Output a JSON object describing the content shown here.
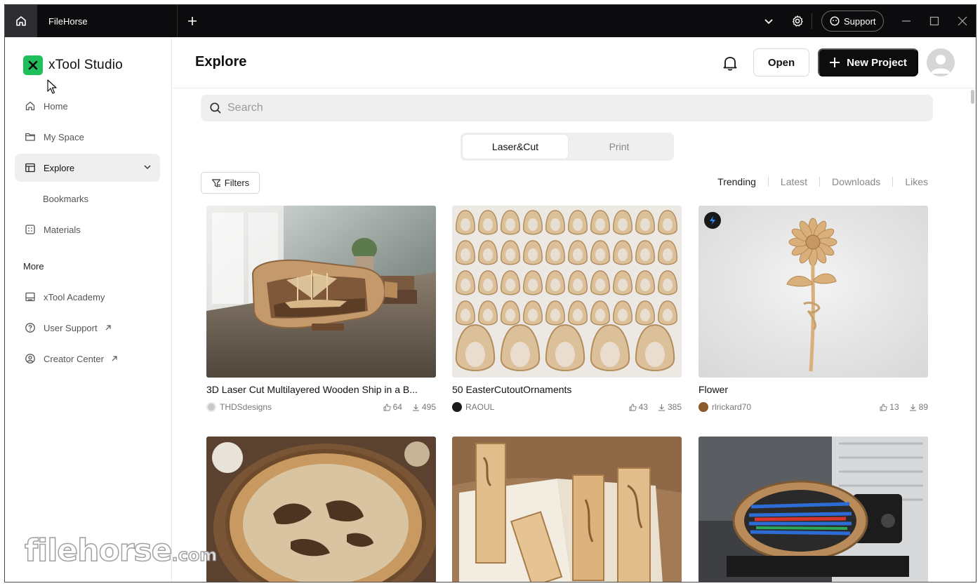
{
  "titlebar": {
    "tab_title": "FileHorse",
    "support_label": "Support"
  },
  "sidebar": {
    "app_name": "xTool Studio",
    "items": [
      {
        "label": "Home",
        "icon": "home-icon"
      },
      {
        "label": "My Space",
        "icon": "folder-icon"
      },
      {
        "label": "Explore",
        "icon": "explore-icon"
      },
      {
        "label": "Bookmarks"
      },
      {
        "label": "Materials",
        "icon": "grid-icon"
      }
    ],
    "more_label": "More",
    "more_items": [
      {
        "label": "xTool Academy",
        "icon": "academy-icon"
      },
      {
        "label": "User Support",
        "icon": "help-icon"
      },
      {
        "label": "Creator Center",
        "icon": "user-circle-icon"
      }
    ]
  },
  "header": {
    "title": "Explore",
    "open_label": "Open",
    "new_project_label": "New Project"
  },
  "search": {
    "placeholder": "Search",
    "value": ""
  },
  "segment": {
    "options": [
      "Laser&Cut",
      "Print"
    ],
    "selected": "Laser&Cut"
  },
  "filters_label": "Filters",
  "sort": {
    "options": [
      "Trending",
      "Latest",
      "Downloads",
      "Likes"
    ],
    "selected": "Trending"
  },
  "cards": [
    {
      "title": "3D Laser Cut Multilayered Wooden Ship in a B...",
      "author": "THDSdesigns",
      "likes": "64",
      "downloads": "495"
    },
    {
      "title": "50 EasterCutoutOrnaments",
      "author": "RAOUL",
      "likes": "43",
      "downloads": "385"
    },
    {
      "title": "Flower",
      "author": "rlrickard70",
      "likes": "13",
      "downloads": "89"
    }
  ],
  "watermark": {
    "text": "filehorse",
    "suffix": ".com"
  },
  "colors": {
    "brand_green": "#1fc05b",
    "titlebar_bg": "#0c0c0e",
    "primary_button": "#0d0d0d",
    "active_nav_bg": "#efefef"
  }
}
